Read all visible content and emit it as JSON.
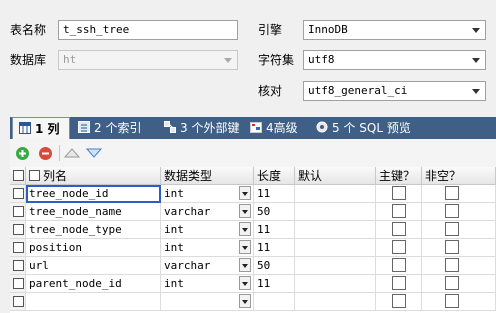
{
  "form": {
    "table_name_label": "表名称",
    "table_name_value": "t_ssh_tree",
    "database_label": "数据库",
    "database_value": "ht",
    "engine_label": "引擎",
    "engine_value": "InnoDB",
    "charset_label": "字符集",
    "charset_value": "utf8",
    "collation_label": "核对",
    "collation_value": "utf8_general_ci"
  },
  "tabs": [
    {
      "label": "1 列",
      "icon": "columns-icon"
    },
    {
      "label": "2 个索引",
      "icon": "index-icon"
    },
    {
      "label": "3 个外部键",
      "icon": "foreign-key-icon"
    },
    {
      "label": "4高级",
      "icon": "advanced-icon"
    },
    {
      "label": "5 个 SQL 预览",
      "icon": "sql-preview-icon"
    }
  ],
  "toolbar": {
    "add": "add-icon",
    "remove": "remove-icon",
    "up": "move-up-icon",
    "down": "move-down-icon"
  },
  "grid": {
    "headers": [
      "列名",
      "数据类型",
      "长度",
      "默认",
      "主键？",
      "非空？"
    ],
    "rows": [
      {
        "name": "tree_node_id",
        "type": "int",
        "length": "11"
      },
      {
        "name": "tree_node_name",
        "type": "varchar",
        "length": "50"
      },
      {
        "name": "tree_node_type",
        "type": "int",
        "length": "11"
      },
      {
        "name": "position",
        "type": "int",
        "length": "11"
      },
      {
        "name": "url",
        "type": "varchar",
        "length": "50"
      },
      {
        "name": "parent_node_id",
        "type": "int",
        "length": "11"
      },
      {
        "name": "",
        "type": "",
        "length": ""
      }
    ]
  },
  "colors": {
    "tabbar": "#3f5f86",
    "selection": "#2a60c4"
  }
}
